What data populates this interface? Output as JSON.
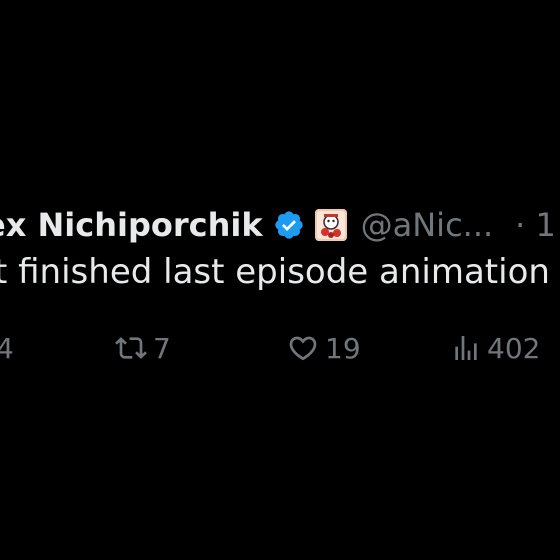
{
  "tweet": {
    "display_name": "ex Nichiporchik",
    "handle": "@aNic...",
    "time_separator": "· 1",
    "text": "t finished last episode animation"
  },
  "actions": {
    "reply_count": "4",
    "repost_count": "7",
    "like_count": "19",
    "views_count": "402"
  },
  "icons": {
    "verified": "verified-badge-icon",
    "profile_badge": "affiliate-badge-icon",
    "reply": "reply-icon",
    "repost": "repost-icon",
    "like": "heart-icon",
    "views": "views-chart-icon"
  },
  "colors": {
    "background": "#000000",
    "text_primary": "#e7e9ea",
    "text_secondary": "#71767b",
    "verified_blue": "#1d9bf0"
  }
}
